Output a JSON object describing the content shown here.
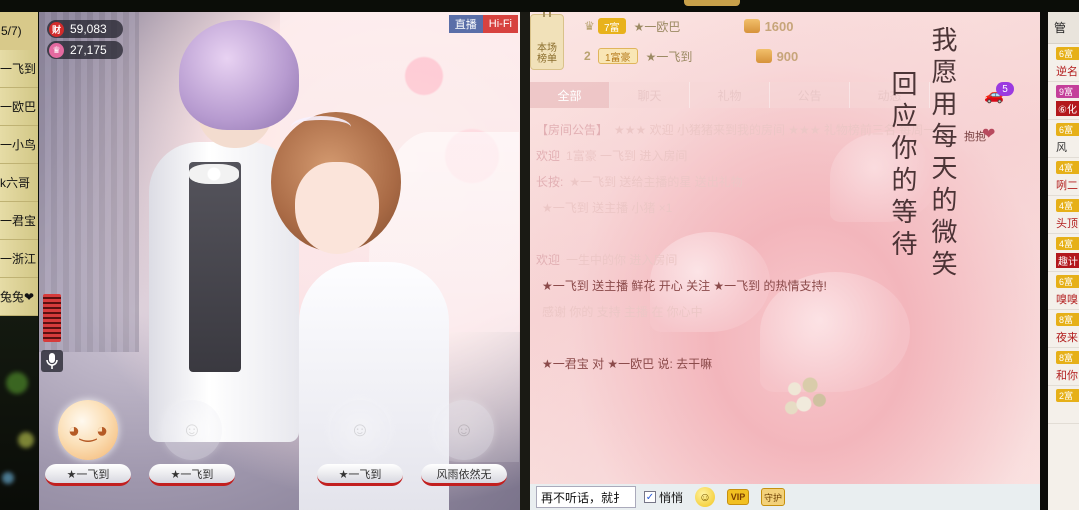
{
  "left_list": {
    "header": "5/7)",
    "items": [
      "一飞到",
      "一欧巴",
      "一小鸟",
      "k六哥",
      "一君宝",
      "一浙江",
      "兔兔❤"
    ]
  },
  "stage": {
    "wealth_value": "59,083",
    "charm_value": "27,175",
    "badge_live": "直播",
    "badge_hifi": "Hi-Fi",
    "queue": [
      {
        "name": "★一飞到"
      },
      {
        "name": "★一飞到"
      },
      {
        "name": "★一飞到"
      },
      {
        "name": "风雨依然无"
      }
    ],
    "icons": {
      "wealth": "wealth-icon",
      "charm": "charm-icon",
      "mic": "microphone-icon"
    }
  },
  "rank": {
    "tag_text": "本场榜单",
    "rows": [
      {
        "num": "",
        "level": "7富",
        "name": "★一欧巴",
        "score": "1600"
      },
      {
        "num": "2",
        "level": "1富豪",
        "name": "★一飞到",
        "score": "900"
      }
    ]
  },
  "chat": {
    "tabs": [
      "全部",
      "聊天",
      "礼物",
      "公告",
      "动态"
    ],
    "car_count": "5",
    "poem": {
      "col1": "我愿用每天的微笑",
      "col2": "回应你的等待"
    },
    "hug_label": "抱抱",
    "messages": [
      {
        "nick": "【房间公告】",
        "body": "★★★ 欢迎 小猪猪来到我的房间 ★★★ 礼物榜前三名 每周一 ",
        "bright": false
      },
      {
        "nick": "欢迎",
        "body": "1富豪 一飞到 进入房间",
        "bright": false
      },
      {
        "nick": "长按:",
        "body": "★一飞到 送给主播的星 送出礼物",
        "bright": false
      },
      {
        "nick": "",
        "body": "★一飞到 送主播 小猪 ×1",
        "bright": false
      },
      {
        "nick": "",
        "body": "",
        "bright": false
      },
      {
        "nick": "欢迎",
        "body": "一生中的你 进入房间",
        "bright": false
      },
      {
        "nick": "",
        "body": "★一飞到 送主播 鲜花 开心 关注 ★一飞到 的热情支持!",
        "bright": true
      },
      {
        "nick": "",
        "body": "感谢 你的 支持 主播 在 你心中",
        "bright": false
      },
      {
        "nick": "",
        "body": "",
        "bright": false
      },
      {
        "nick": "",
        "body": "★一君宝 对 ★一欧巴 说: 去干嘛",
        "bright": true
      }
    ],
    "input_value": "再不听话，就扌",
    "whisper_label": "悄悄",
    "whisper_checked": "✓",
    "vip_label": "VIP",
    "guard_label": "守护"
  },
  "right_list": {
    "header": "管",
    "items": [
      {
        "level": "6富",
        "name": "逆名",
        "style": "plain",
        "pink": false
      },
      {
        "level": "9富",
        "name": "⑥化",
        "style": "boxed",
        "pink": true
      },
      {
        "level": "6富",
        "name": "风",
        "style": "dark",
        "pink": false
      },
      {
        "level": "4富",
        "name": "咧二",
        "style": "plain",
        "pink": false
      },
      {
        "level": "4富",
        "name": "头顶",
        "style": "plain",
        "pink": false
      },
      {
        "level": "4富",
        "name": "趣计",
        "style": "boxed",
        "pink": false
      },
      {
        "level": "6富",
        "name": "嗅嗅",
        "style": "plain",
        "pink": false
      },
      {
        "level": "8富",
        "name": "夜来",
        "style": "plain",
        "pink": false
      },
      {
        "level": "8富",
        "name": "和你",
        "style": "plain",
        "pink": false
      },
      {
        "level": "2富",
        "name": "",
        "style": "plain",
        "pink": false
      }
    ]
  },
  "colors": {
    "accent_red": "#d7423f",
    "live_blue": "#5a6ea8",
    "gold": "#e8b21c"
  }
}
